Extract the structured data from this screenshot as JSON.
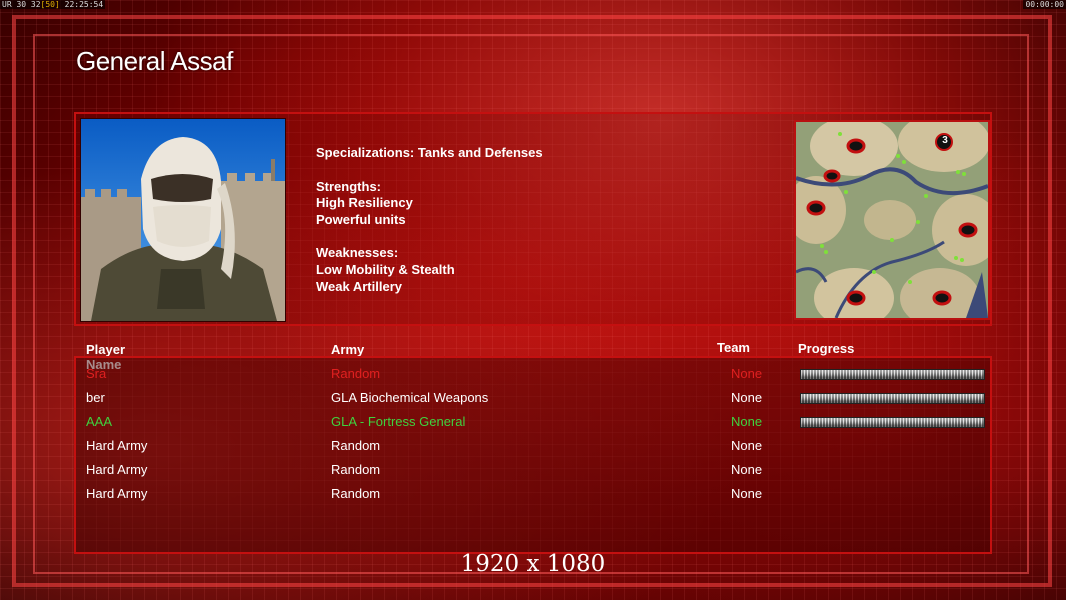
{
  "hud": {
    "left_prefix": "UR 30 32",
    "left_pct": "[50]",
    "left_time": "22:25:54",
    "right_time": "00:00:00"
  },
  "general": {
    "name": "General Assaf",
    "specializations": "Specializations: Tanks and Defenses",
    "strengths_header": "Strengths:",
    "strengths": [
      "High Resiliency",
      "Powerful units"
    ],
    "weaknesses_header": "Weaknesses:",
    "weaknesses": [
      "Low Mobility & Stealth",
      "Weak Artillery"
    ]
  },
  "minimap": {
    "start_marker_label": "3"
  },
  "players_table": {
    "headers": {
      "name": "Player Name",
      "army": "Army",
      "team": "Team",
      "progress": "Progress"
    },
    "rows": [
      {
        "name": "Sra",
        "army": "Random",
        "team": "None",
        "color": "#e02020",
        "progress": 1.0,
        "show_progress": true
      },
      {
        "name": "ber",
        "army": "GLA Biochemical Weapons",
        "team": "None",
        "color": "#ffffff",
        "progress": 1.0,
        "show_progress": true
      },
      {
        "name": "AAA",
        "army": "GLA - Fortress General",
        "team": "None",
        "color": "#3fd23f",
        "progress": 1.0,
        "show_progress": true
      },
      {
        "name": "Hard Army",
        "army": "Random",
        "team": "None",
        "color": "#ffffff",
        "progress": 0,
        "show_progress": false
      },
      {
        "name": "Hard Army",
        "army": "Random",
        "team": "None",
        "color": "#ffffff",
        "progress": 0,
        "show_progress": false
      },
      {
        "name": "Hard Army",
        "army": "Random",
        "team": "None",
        "color": "#ffffff",
        "progress": 0,
        "show_progress": false
      }
    ]
  },
  "resolution_label": "1920 x 1080"
}
